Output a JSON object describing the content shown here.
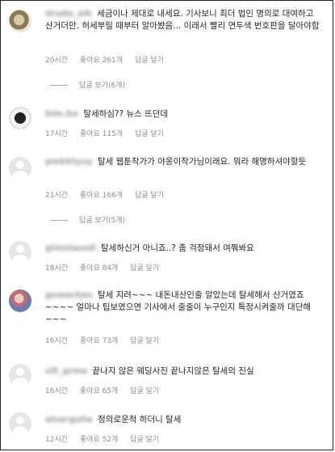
{
  "comments": [
    {
      "username": "drudo_alk",
      "text": "세금이나 제대로 내세요. 기사보니 죄더 법인 명의로 대여하고 산거더만. 허세부릴 때부터 알아봤음... 이래서 빨리 연두색 번호판을 달아야함",
      "time": "20시간",
      "likes": "좋아요 261개",
      "reply": "답글 달기",
      "view_replies": "답글 보기(6개)"
    },
    {
      "username": "bim.hu",
      "text": "탈세하심?? 뉴스 뜨던데",
      "time": "17시간",
      "likes": "좋아요 115개",
      "reply": "답글 달기"
    },
    {
      "username": "pmkktyuy",
      "text": "탈세 웹툰작가가 야옹이작가님이래요. 뭐라 해명하셔야할듯",
      "time": "21시간",
      "likes": "좋아요 166개",
      "reply": "답글 달기",
      "view_replies": "답글 보기(5개)"
    },
    {
      "username": "gimstaun0",
      "text": "탈세하신거 아니죠..? 좀 걱정돼서 여쭤봐요",
      "time": "18시간",
      "likes": "좋아요 84개",
      "reply": "답글 달기"
    },
    {
      "username": "gowaches",
      "text": "탈세 지려~~~ 내돈내산인줄 알았는데 탈세해서 산거였죠~~~~ 얼마나 팁보였으면 기사에서 줄줄이 누구인지 특정시켜줄까 대단해~~~",
      "time": "16시간",
      "likes": "좋아요 73개",
      "reply": "답글 달기"
    },
    {
      "username": "ult_grma",
      "text": "끝나지 않은 웨딩사진 끝나지않은 탈세의 진실",
      "time": "16시간",
      "likes": "좋아요 65개",
      "reply": "답글 달기"
    },
    {
      "username": "alsarguhe",
      "text": "정의로운척 하더니 탈세",
      "time": "12시간",
      "likes": "좋아요 52개",
      "reply": "답글 달기"
    }
  ]
}
